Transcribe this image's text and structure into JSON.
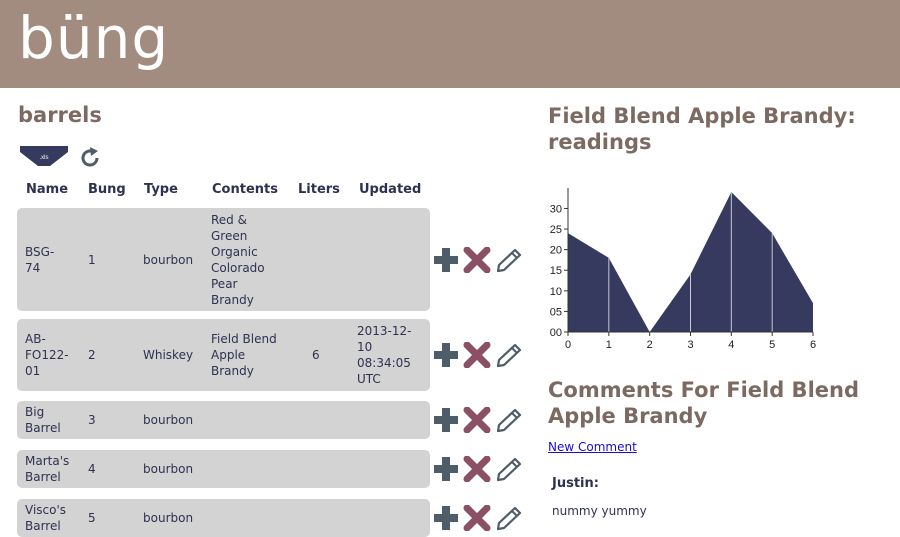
{
  "app": {
    "logo": "büng"
  },
  "barrels": {
    "title": "barrels",
    "columns": [
      "Name",
      "Bung",
      "Type",
      "Contents",
      "Liters",
      "Updated"
    ],
    "rows": [
      {
        "name": "BSG-\n74",
        "bung": "1",
        "type": "bourbon",
        "contents": "Red &\nGreen\nOrganic\nColorado\nPear\nBrandy",
        "liters": "",
        "updated": ""
      },
      {
        "name": "AB-\nFO122-\n01",
        "bung": "2",
        "type": "Whiskey",
        "contents": "Field Blend\nApple\nBrandy",
        "liters": "6",
        "updated": "2013-12-\n10\n08:34:05\nUTC"
      },
      {
        "name": "Big\nBarrel",
        "bung": "3",
        "type": "bourbon",
        "contents": "",
        "liters": "",
        "updated": ""
      },
      {
        "name": "Marta's\nBarrel",
        "bung": "4",
        "type": "bourbon",
        "contents": "",
        "liters": "",
        "updated": ""
      },
      {
        "name": "Visco's\nBarrel",
        "bung": "5",
        "type": "bourbon",
        "contents": "",
        "liters": "",
        "updated": ""
      }
    ]
  },
  "readings": {
    "title": "Field Blend Apple Brandy: readings"
  },
  "chart_data": {
    "type": "area",
    "title": "",
    "xlabel": "",
    "ylabel": "",
    "x": [
      0,
      1,
      2,
      3,
      4,
      5,
      6
    ],
    "series": [
      {
        "values": [
          24,
          18,
          0,
          14,
          34,
          24,
          7
        ]
      }
    ],
    "xticks": [
      "0",
      "1",
      "2",
      "3",
      "4",
      "5",
      "6"
    ],
    "yticks": [
      "00",
      "05",
      "10",
      "15",
      "20",
      "25",
      "30"
    ],
    "ylim": [
      0,
      34
    ],
    "xlim": [
      0,
      6
    ],
    "fill_color": "#363a5e",
    "grid": false
  },
  "comments": {
    "title": "Comments For Field Blend Apple Brandy",
    "new_comment_label": "New Comment",
    "items": [
      {
        "author": "Justin:",
        "text": "nummy yummy"
      }
    ]
  },
  "icons": {
    "export": "xls-download-icon",
    "refresh": "refresh-icon",
    "add": "plus-icon",
    "delete": "x-icon",
    "edit": "pencil-icon"
  },
  "colors": {
    "header_bg": "#a28b7f",
    "title_brown": "#7c6a62",
    "row_bg": "#d3d3d3",
    "navy": "#2f3150",
    "add_icon": "#4d5d6a",
    "delete_icon": "#8c5066"
  }
}
